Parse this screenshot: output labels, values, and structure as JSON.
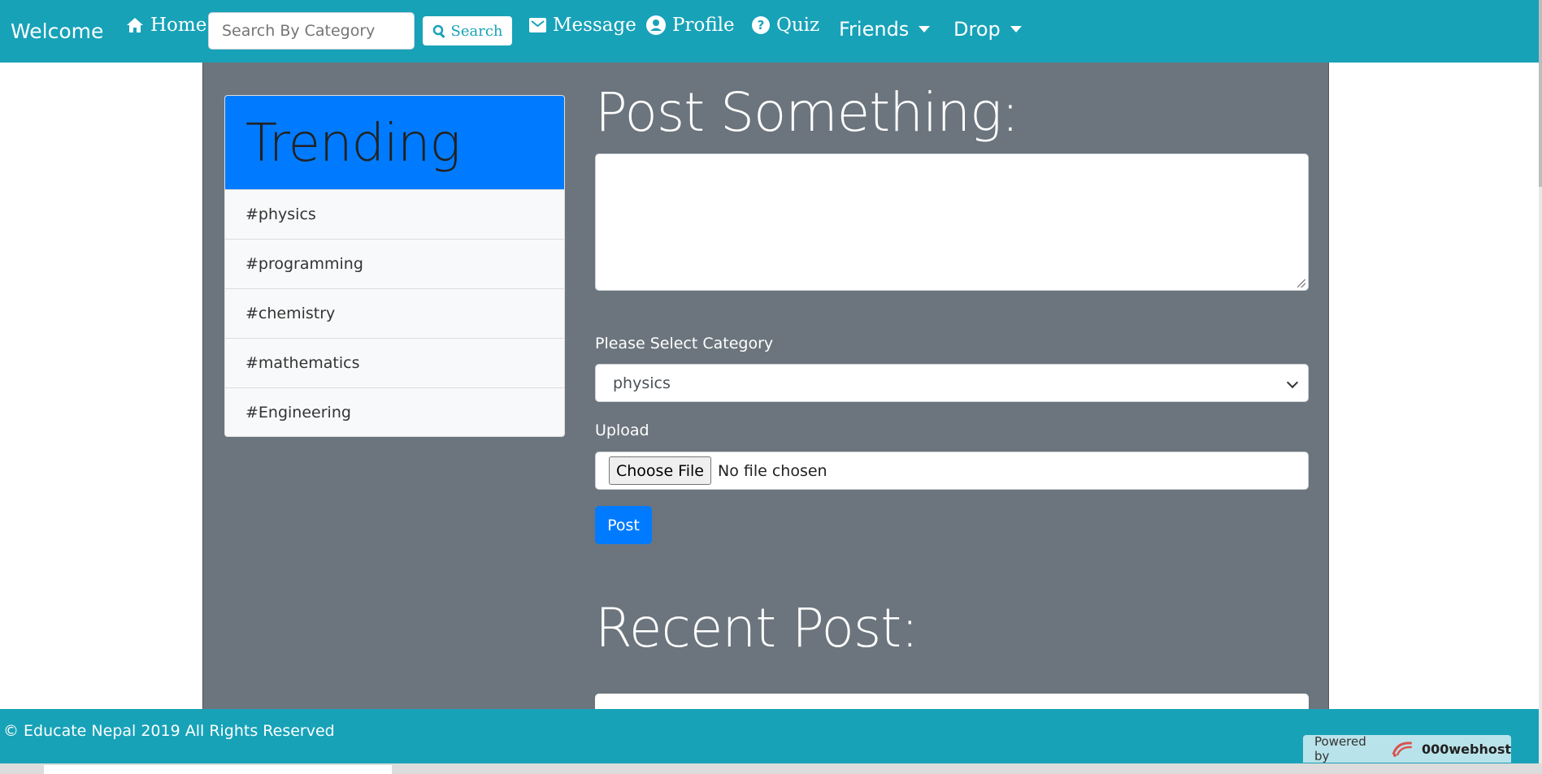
{
  "navbar": {
    "brand": "Welcome",
    "home": "Home",
    "search_placeholder": "Search By Category",
    "search_button": "Search",
    "message": "Message",
    "profile": "Profile",
    "quiz": "Quiz",
    "friends": "Friends",
    "drop": "Drop"
  },
  "trending": {
    "title": "Trending",
    "items": [
      "#physics",
      "#programming",
      "#chemistry",
      "#mathematics",
      "#Engineering"
    ]
  },
  "post": {
    "title": "Post Something:",
    "textarea_value": "",
    "category_label": "Please Select Category",
    "category_selected": "physics",
    "upload_label": "Upload",
    "choose_file": "Choose File",
    "no_file": "No file chosen",
    "post_button": "Post"
  },
  "recent": {
    "title": "Recent Post:"
  },
  "footer": {
    "copyright": "© Educate Nepal 2019 All Rights Reserved",
    "powered_label": "Powered by",
    "powered_brand": "000webhost"
  },
  "colors": {
    "navbar": "#17a2b8",
    "container": "#6c757d",
    "primary": "#007bff"
  }
}
